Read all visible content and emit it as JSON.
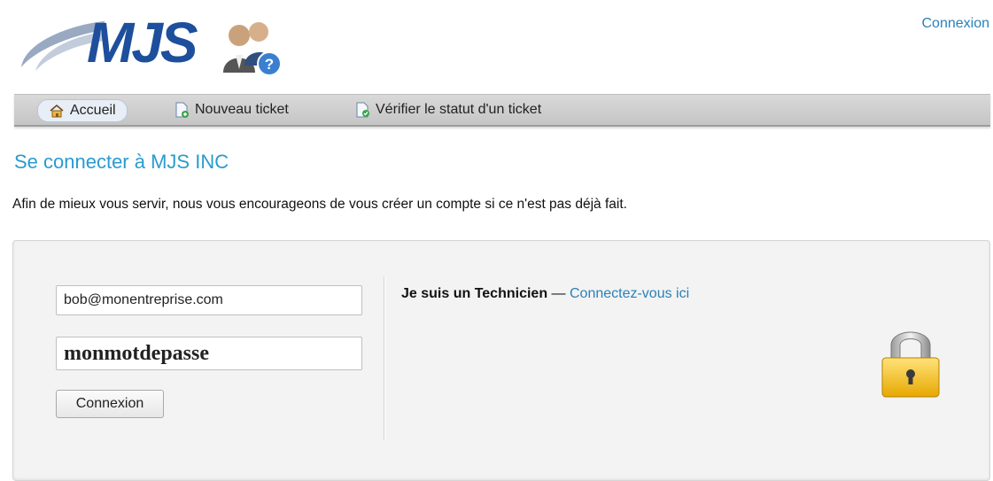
{
  "header": {
    "logo_text": "MJS",
    "login_link": "Connexion"
  },
  "nav": {
    "items": [
      {
        "label": "Accueil",
        "icon": "home-icon",
        "active": true
      },
      {
        "label": "Nouveau ticket",
        "icon": "new-ticket-icon",
        "active": false
      },
      {
        "label": "Vérifier le statut d'un ticket",
        "icon": "check-status-icon",
        "active": false
      }
    ]
  },
  "main": {
    "title": "Se connecter à MJS INC",
    "intro": "Afin de mieux vous servir, nous vous encourageons de vous créer un compte si ce n'est pas déjà fait."
  },
  "login_form": {
    "email_value": "bob@monentreprise.com",
    "password_value": "monmotdepasse",
    "submit_label": "Connexion"
  },
  "technician": {
    "label": "Je suis un Technicien",
    "separator": " — ",
    "link": "Connectez-vous ici"
  },
  "colors": {
    "accent": "#2a9bcf",
    "link": "#2a80b9",
    "logo": "#1d4f9c"
  }
}
